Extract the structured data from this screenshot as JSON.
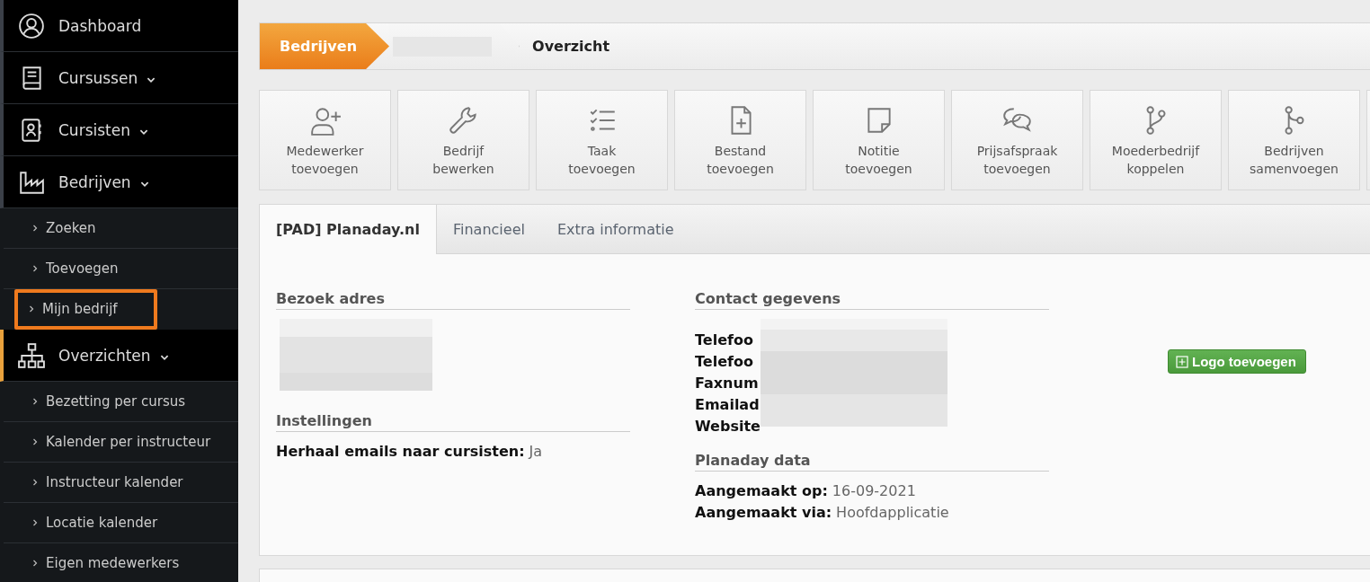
{
  "sidebar": {
    "items": [
      {
        "label": "Dashboard",
        "kind": "link",
        "selected": false
      },
      {
        "label": "Cursussen",
        "kind": "group",
        "selected": false
      },
      {
        "label": "Cursisten",
        "kind": "group",
        "selected": false
      },
      {
        "label": "Bedrijven",
        "kind": "group",
        "selected": false,
        "expanded": true,
        "children": [
          {
            "label": "Zoeken",
            "highlighted": false
          },
          {
            "label": "Toevoegen",
            "highlighted": false
          },
          {
            "label": "Mijn bedrijf",
            "highlighted": true
          }
        ]
      },
      {
        "label": "Overzichten",
        "kind": "group",
        "selected": true,
        "expanded": true,
        "children": [
          {
            "label": "Bezetting per cursus",
            "highlighted": false
          },
          {
            "label": "Kalender per instructeur",
            "highlighted": false
          },
          {
            "label": "Instructeur kalender",
            "highlighted": false
          },
          {
            "label": "Locatie kalender",
            "highlighted": false
          },
          {
            "label": "Eigen medewerkers",
            "highlighted": false
          }
        ]
      }
    ]
  },
  "breadcrumb": [
    {
      "kind": "root",
      "label": "Bedrijven"
    },
    {
      "kind": "redacted"
    },
    {
      "kind": "current",
      "label": "Overzicht"
    }
  ],
  "actions": [
    {
      "kind": "action",
      "label": "Medewerker toevoegen"
    },
    {
      "kind": "action",
      "label": "Bedrijf bewerken"
    },
    {
      "kind": "action",
      "label": "Taak toevoegen"
    },
    {
      "kind": "action",
      "label": "Bestand toevoegen"
    },
    {
      "kind": "action",
      "label": "Notitie toevoegen"
    },
    {
      "kind": "action",
      "label": "Prijsafspraak toevoegen"
    },
    {
      "kind": "action",
      "label": "Moederbedrijf koppelen"
    },
    {
      "kind": "action",
      "label": "Bedrijven samenvoegen"
    },
    {
      "kind": "empty"
    }
  ],
  "tabs": [
    {
      "label": "[PAD] Planaday.nl",
      "selected": true
    },
    {
      "label": "Financieel",
      "selected": false
    },
    {
      "label": "Extra informatie",
      "selected": false
    }
  ],
  "left_sections": [
    {
      "title": "Bezoek adres",
      "kind": "redacted"
    },
    {
      "title": "Instellingen",
      "kind": "fields",
      "fields": [
        {
          "label": "Herhaal emails naar cursisten:",
          "value": "Ja"
        }
      ]
    }
  ],
  "right_sections": [
    {
      "title": "Contact gegevens",
      "kind": "redacted-fields",
      "fields": [
        {
          "label": "Telefoo"
        },
        {
          "label": "Telefoo"
        },
        {
          "label": "Faxnum"
        },
        {
          "label": "Emailad"
        },
        {
          "label": "Website"
        }
      ]
    },
    {
      "title": "Planaday data",
      "kind": "fields",
      "fields": [
        {
          "label": "Aangemaakt op:",
          "value": "16-09-2021"
        },
        {
          "label": "Aangemaakt via:",
          "value": "Hoofdapplicatie"
        }
      ]
    }
  ],
  "logo_button": {
    "label": "Logo toevoegen"
  }
}
